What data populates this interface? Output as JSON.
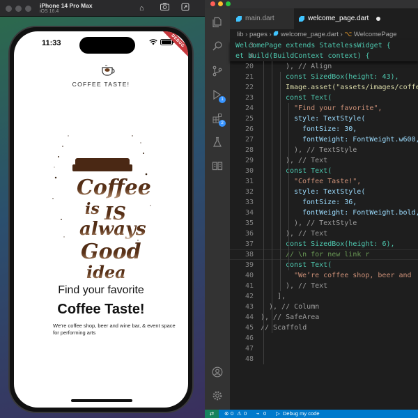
{
  "simulator": {
    "device_name": "iPhone 14 Pro Max",
    "ios_version": "iOS 16.4",
    "status_time": "11:33",
    "debug_banner": "DEBUG",
    "app": {
      "brand": "COFFEE TASTE!",
      "hero_image": "coffee-is-always-good-idea-illustration",
      "headline_1": "Find your favorite",
      "headline_2": "Coffee Taste!",
      "tagline": "We’re coffee shop, beer and wine bar, & event space for performing arts"
    }
  },
  "editor": {
    "tabs": [
      {
        "label": "main.dart",
        "active": false
      },
      {
        "label": "welcome_page.dart",
        "active": true,
        "unsaved": true
      }
    ],
    "breadcrumb": {
      "folder_1": "lib",
      "folder_2": "pages",
      "file": "welcome_page.dart",
      "symbol": "WelcomePage"
    },
    "sticky_lines": [
      {
        "number": "3",
        "text": "WelcomePage extends StatelessWidget {"
      },
      {
        "number": "4",
        "text": "et build(BuildContext context) {"
      }
    ],
    "lines": [
      {
        "number": "20",
        "text": "), // Align"
      },
      {
        "number": "21",
        "text": "const SizedBox(height: 43),"
      },
      {
        "number": "22",
        "text": "Image.asset(\"assets/images/coffee"
      },
      {
        "number": "23",
        "text": "const Text("
      },
      {
        "number": "24",
        "text": "\"Find your favorite\","
      },
      {
        "number": "25",
        "text": "style: TextStyle("
      },
      {
        "number": "26",
        "text": "fontSize: 30,"
      },
      {
        "number": "27",
        "text": "fontWeight: FontWeight.w600,"
      },
      {
        "number": "28",
        "text": "), // TextStyle"
      },
      {
        "number": "29",
        "text": "), // Text"
      },
      {
        "number": "30",
        "text": "const Text("
      },
      {
        "number": "31",
        "text": "\"Coffee Taste!\","
      },
      {
        "number": "32",
        "text": "style: TextStyle("
      },
      {
        "number": "33",
        "text": "fontSize: 36,"
      },
      {
        "number": "34",
        "text": "fontWeight: FontWeight.bold,"
      },
      {
        "number": "35",
        "text": "), // TextStyle"
      },
      {
        "number": "36",
        "text": "), // Text"
      },
      {
        "number": "37",
        "text": "const SizedBox(height: 6),"
      },
      {
        "number": "38",
        "text": "// \\n for new link r"
      },
      {
        "number": "39",
        "text": "const Text("
      },
      {
        "number": "40",
        "text": "\"We’re coffee shop, beer and"
      },
      {
        "number": "41",
        "text": "), // Text"
      },
      {
        "number": "42",
        "text": "],"
      },
      {
        "number": "43",
        "text": "), // Column"
      },
      {
        "number": "44",
        "text": "), // SafeArea"
      },
      {
        "number": "45",
        "text": "// Scaffold"
      },
      {
        "number": "46",
        "text": ""
      },
      {
        "number": "47",
        "text": ""
      },
      {
        "number": "48",
        "text": ""
      }
    ],
    "activity_badges": {
      "debug": "1",
      "extensions": "2"
    },
    "status_bar": {
      "errors": "0",
      "warnings": "0",
      "ports": "0",
      "debug_target": "Debug my code"
    }
  }
}
